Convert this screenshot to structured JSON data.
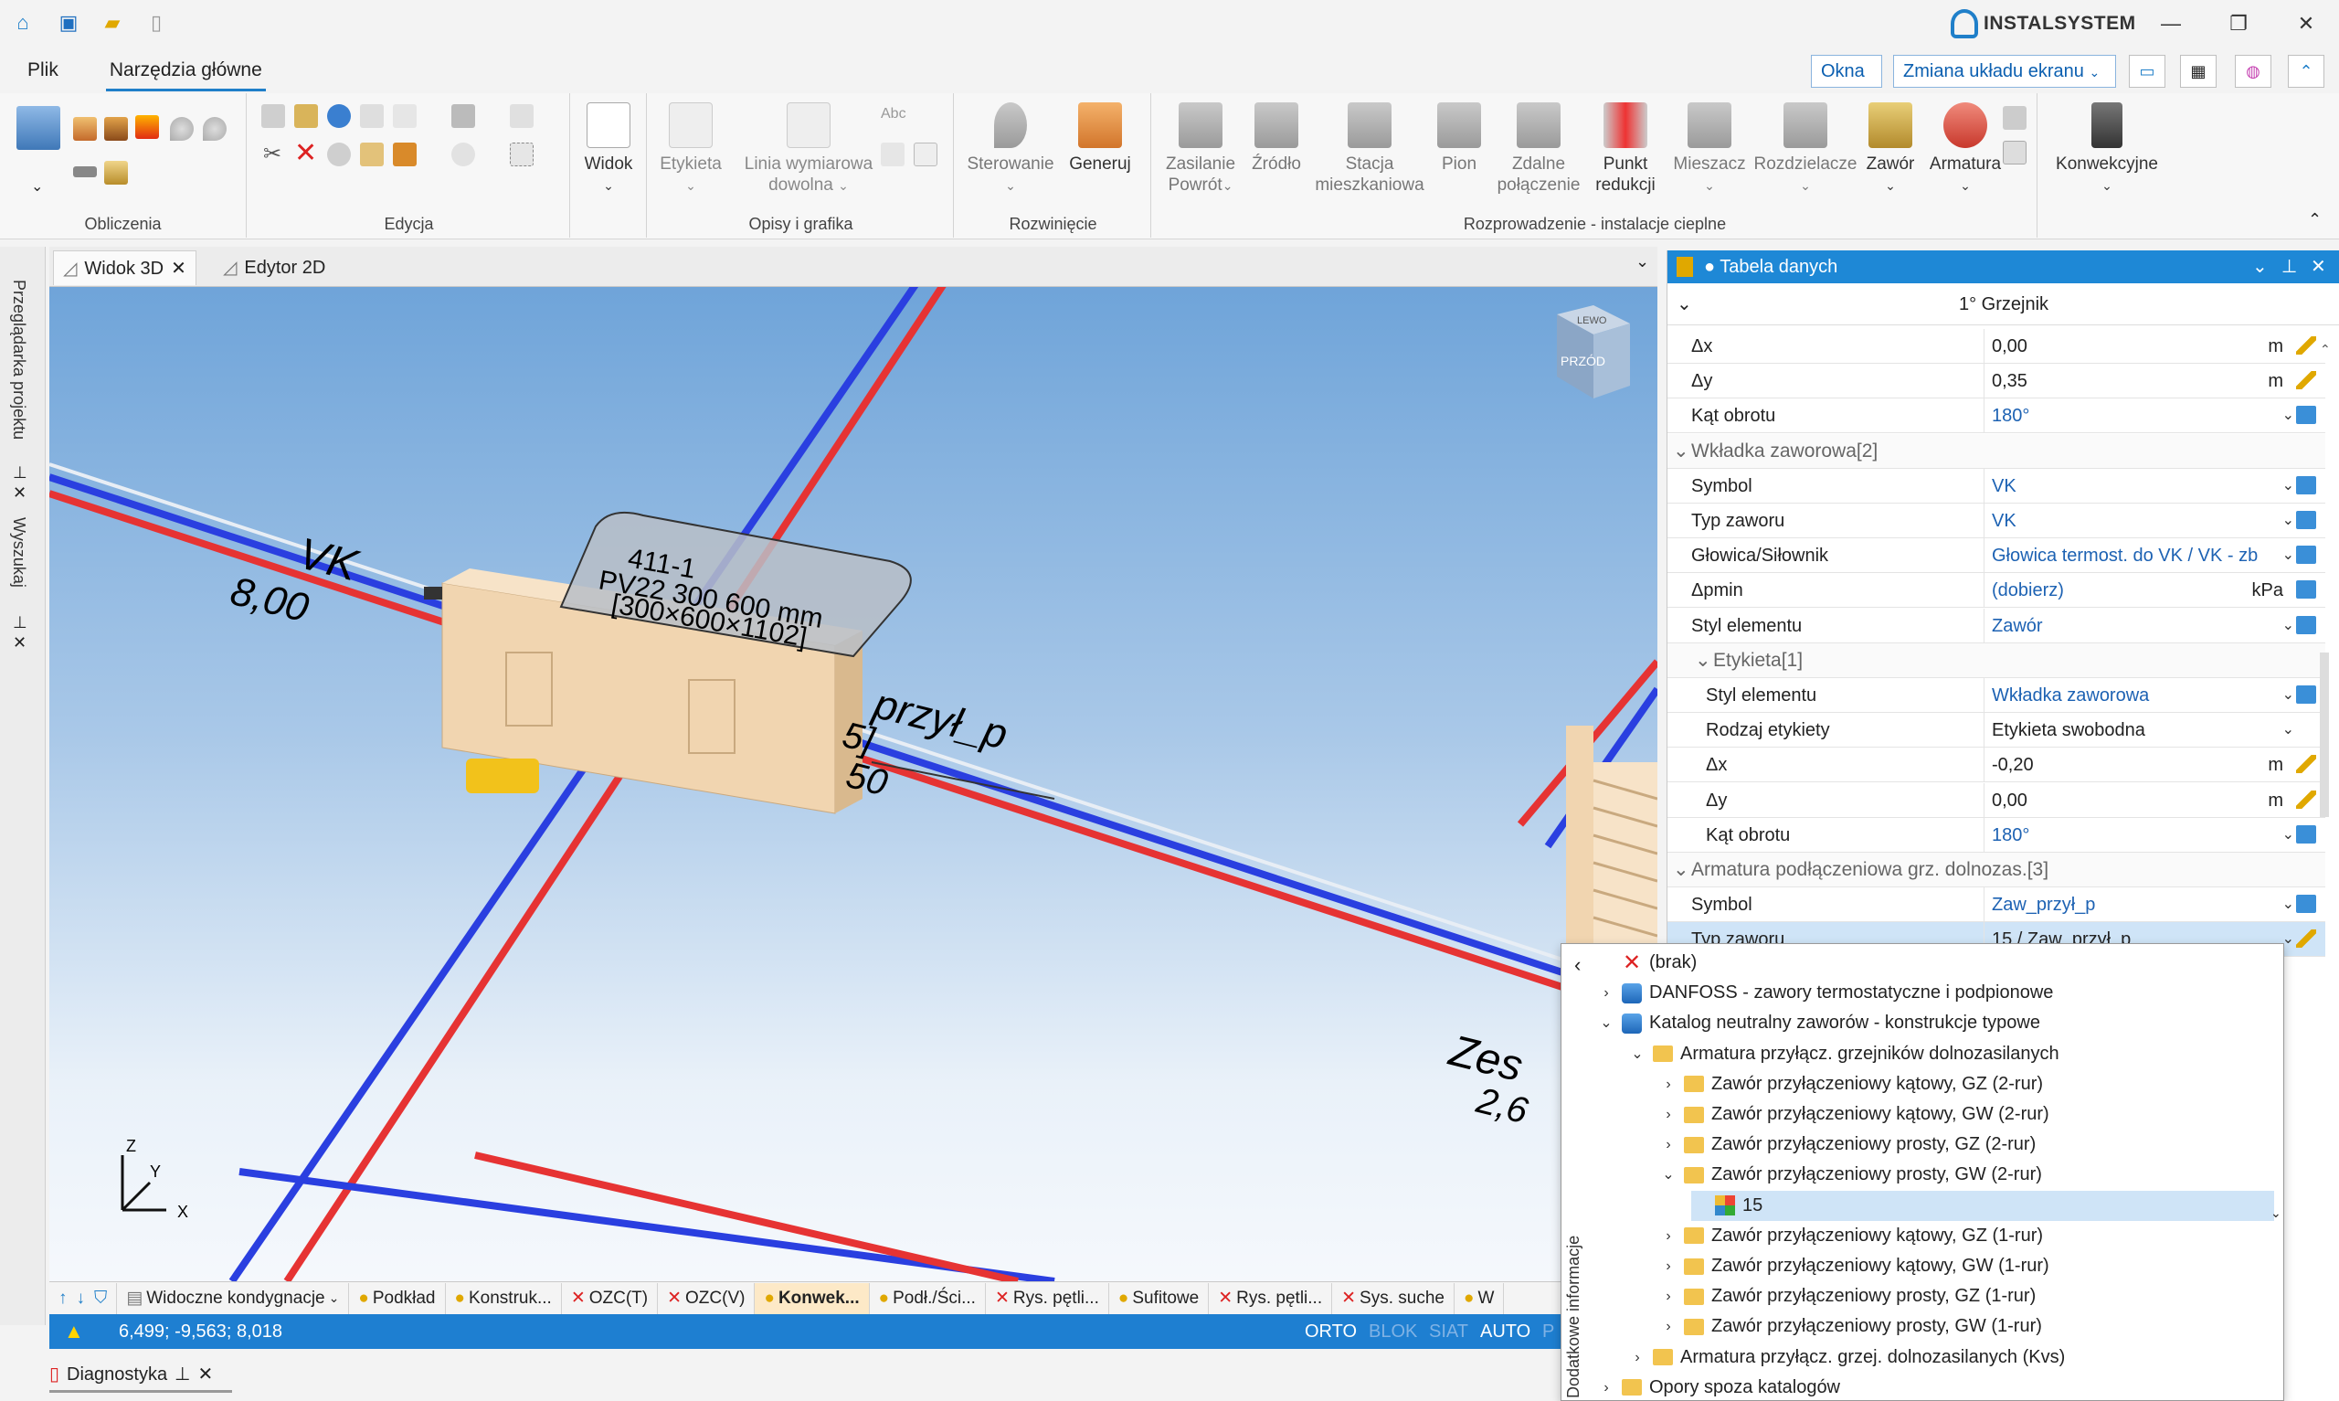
{
  "titlebar": {
    "brand": "INSTALSYSTEM",
    "quick_access": [
      "home-icon",
      "save-icon",
      "open-icon",
      "new-file-icon"
    ],
    "minimize": "—",
    "restore": "❐",
    "close": "✕"
  },
  "menu": {
    "tabs": [
      {
        "label": "Plik",
        "active": false
      },
      {
        "label": "Narzędzia główne",
        "active": true
      }
    ],
    "windows_dd": "Okna",
    "layout_dd": "Zmiana układu ekranu"
  },
  "ribbon": {
    "groups": [
      {
        "label": "Obliczenia"
      },
      {
        "label": "Edycja"
      },
      {
        "label": "Opisy i grafika"
      },
      {
        "label": "Rozwinięcie"
      },
      {
        "label": "Rozprowadzenie - instalacje cieplne"
      }
    ],
    "buttons": {
      "widok": "Widok",
      "etykieta": "Etykieta",
      "linia": "Linia wymiarowa",
      "linia2": "dowolna",
      "abc": "Abc",
      "sterowanie": "Sterowanie",
      "generuj": "Generuj",
      "zasilanie": "Zasilanie",
      "powrot": "Powrót",
      "zrodlo": "Źródło",
      "stacja": "Stacja",
      "stacja2": "mieszkaniowa",
      "pion": "Pion",
      "zdalne": "Zdalne",
      "zdalne2": "połączenie",
      "punkt": "Punkt",
      "punkt2": "redukcji",
      "mieszacz": "Mieszacz",
      "rozdzielacze": "Rozdzielacze",
      "zawor": "Zawór",
      "armatura": "Armatura",
      "konwekcyjne": "Konwekcyjne"
    }
  },
  "doctabs": [
    {
      "label": "Widok 3D",
      "active": true
    },
    {
      "label": "Edytor 2D",
      "active": false
    }
  ],
  "leftside": {
    "browser": "Przeglądarka projektu",
    "search": "Wyszukaj"
  },
  "viewport": {
    "cube_top": "LEWO",
    "cube_front": "PRZÓD",
    "vk_label": "VK",
    "vk_value": "8,00",
    "tag_line1": "411-1",
    "tag_line2": "PV22 300 600 mm",
    "tag_line3": "[300×600×1102]",
    "przyl_label": "przył_p",
    "przyl_num1": "5]",
    "przyl_num2": "50",
    "zes_label": "Zes",
    "zes_value": "2,6",
    "axis_z": "Z",
    "axis_y": "Y",
    "axis_x": "X"
  },
  "layerbar": {
    "visible_levels": "Widoczne kondygnacje",
    "layers": [
      {
        "label": "Podkład",
        "type": "bulb"
      },
      {
        "label": "Konstruk...",
        "type": "bulb"
      },
      {
        "label": "OZC(T)",
        "type": "x"
      },
      {
        "label": "OZC(V)",
        "type": "x"
      },
      {
        "label": "Konwek...",
        "type": "bulb",
        "active": true
      },
      {
        "label": "Podł./Ści...",
        "type": "bulb"
      },
      {
        "label": "Rys. pętli...",
        "type": "x"
      },
      {
        "label": "Sufitowe",
        "type": "bulb"
      },
      {
        "label": "Rys. pętli...",
        "type": "x"
      },
      {
        "label": "Sys. suche",
        "type": "x"
      },
      {
        "label": "W",
        "type": "bulb"
      }
    ]
  },
  "statusbar": {
    "coords": "6,499; -9,563; 8,018",
    "modes": [
      "ORTO",
      "BLOK",
      "SIAT",
      "AUTO",
      "P"
    ]
  },
  "diagnostics": {
    "label": "Diagnostyka"
  },
  "panel": {
    "title": "● Tabela danych",
    "element": "1° Grzejnik",
    "rows": [
      {
        "k": "Δx",
        "v": "0,00",
        "u": "m",
        "icon": "pencil",
        "indent": 1
      },
      {
        "k": "Δy",
        "v": "0,35",
        "u": "m",
        "icon": "pencil",
        "indent": 1
      },
      {
        "k": "Kąt obrotu",
        "v": "180°",
        "dd": true,
        "blue": true,
        "icon": "link",
        "indent": 1
      },
      {
        "section": "Wkładka zaworowa[2]"
      },
      {
        "k": "Symbol",
        "v": "VK",
        "dd": true,
        "blue": true,
        "icon": "link",
        "indent": 1
      },
      {
        "k": "Typ zaworu",
        "v": "VK",
        "dd": true,
        "blue": true,
        "icon": "link",
        "indent": 1
      },
      {
        "k": "Głowica/Siłownik",
        "v": "Głowica termost. do VK / VK - zb",
        "dd": true,
        "blue": true,
        "icon": "link",
        "indent": 1
      },
      {
        "k": "Δpmin",
        "v": "(dobierz)",
        "u": "kPa",
        "blue": true,
        "icon": "link",
        "indent": 1
      },
      {
        "k": "Styl elementu",
        "v": "Zawór",
        "dd": true,
        "blue": true,
        "icon": "link",
        "indent": 1
      },
      {
        "section": "Etykieta[1]",
        "indent": 1
      },
      {
        "k": "Styl elementu",
        "v": "Wkładka zaworowa",
        "dd": true,
        "blue": true,
        "icon": "link",
        "indent": 2
      },
      {
        "k": "Rodzaj etykiety",
        "v": "Etykieta swobodna",
        "dd": true,
        "indent": 2
      },
      {
        "k": "Δx",
        "v": "-0,20",
        "u": "m",
        "icon": "pencil",
        "indent": 2
      },
      {
        "k": "Δy",
        "v": "0,00",
        "u": "m",
        "icon": "pencil",
        "indent": 2
      },
      {
        "k": "Kąt obrotu",
        "v": "180°",
        "dd": true,
        "blue": true,
        "icon": "link",
        "indent": 2
      },
      {
        "section": "Armatura podłączeniowa grz. dolnozas.[3]"
      },
      {
        "k": "Symbol",
        "v": "Zaw_przył_p",
        "dd": true,
        "blue": true,
        "icon": "link",
        "indent": 1
      },
      {
        "k": "Typ zaworu",
        "v": "15 / Zaw_przył_p",
        "dd": true,
        "icon": "pencil",
        "indent": 1,
        "selected": true
      }
    ]
  },
  "dropdown": {
    "items": [
      {
        "label": "(brak)",
        "icon": "x",
        "level": 0,
        "chev": ""
      },
      {
        "label": "DANFOSS - zawory termostatyczne i podpionowe",
        "icon": "db",
        "level": 0,
        "chev": "›"
      },
      {
        "label": "Katalog neutralny zaworów - konstrukcje typowe",
        "icon": "db",
        "level": 0,
        "chev": "⌄"
      },
      {
        "label": "Armatura przyłącz. grzejników dolnozasilanych",
        "icon": "folder",
        "level": 1,
        "chev": "⌄"
      },
      {
        "label": "Zawór przyłączeniowy kątowy, GZ (2-rur)",
        "icon": "folder",
        "level": 2,
        "chev": "›"
      },
      {
        "label": "Zawór przyłączeniowy kątowy, GW (2-rur)",
        "icon": "folder",
        "level": 2,
        "chev": "›"
      },
      {
        "label": "Zawór przyłączeniowy prosty, GZ (2-rur)",
        "icon": "folder",
        "level": 2,
        "chev": "›"
      },
      {
        "label": "Zawór przyłączeniowy prosty, GW (2-rur)",
        "icon": "folder",
        "level": 2,
        "chev": "⌄"
      },
      {
        "label": "15",
        "icon": "value",
        "level": 3,
        "chev": "",
        "selected": true
      },
      {
        "label": "Zawór przyłączeniowy kątowy, GZ (1-rur)",
        "icon": "folder",
        "level": 2,
        "chev": "›"
      },
      {
        "label": "Zawór przyłączeniowy kątowy, GW (1-rur)",
        "icon": "folder",
        "level": 2,
        "chev": "›"
      },
      {
        "label": "Zawór przyłączeniowy prosty, GZ (1-rur)",
        "icon": "folder",
        "level": 2,
        "chev": "›"
      },
      {
        "label": "Zawór przyłączeniowy prosty, GW (1-rur)",
        "icon": "folder",
        "level": 2,
        "chev": "›"
      },
      {
        "label": "Armatura przyłącz. grzej. dolnozasilanych (Kvs)",
        "icon": "folder",
        "level": 1,
        "chev": "›"
      },
      {
        "label": "Opory spoza katalogów",
        "icon": "folder",
        "level": 0,
        "chev": "›"
      }
    ],
    "side_label": "Dodatkowe informacje"
  },
  "colors": {
    "accent": "#1e88d6",
    "supply_pipe": "#e63333",
    "return_pipe": "#2a3fe0",
    "radiator": "#f1d5b0"
  }
}
